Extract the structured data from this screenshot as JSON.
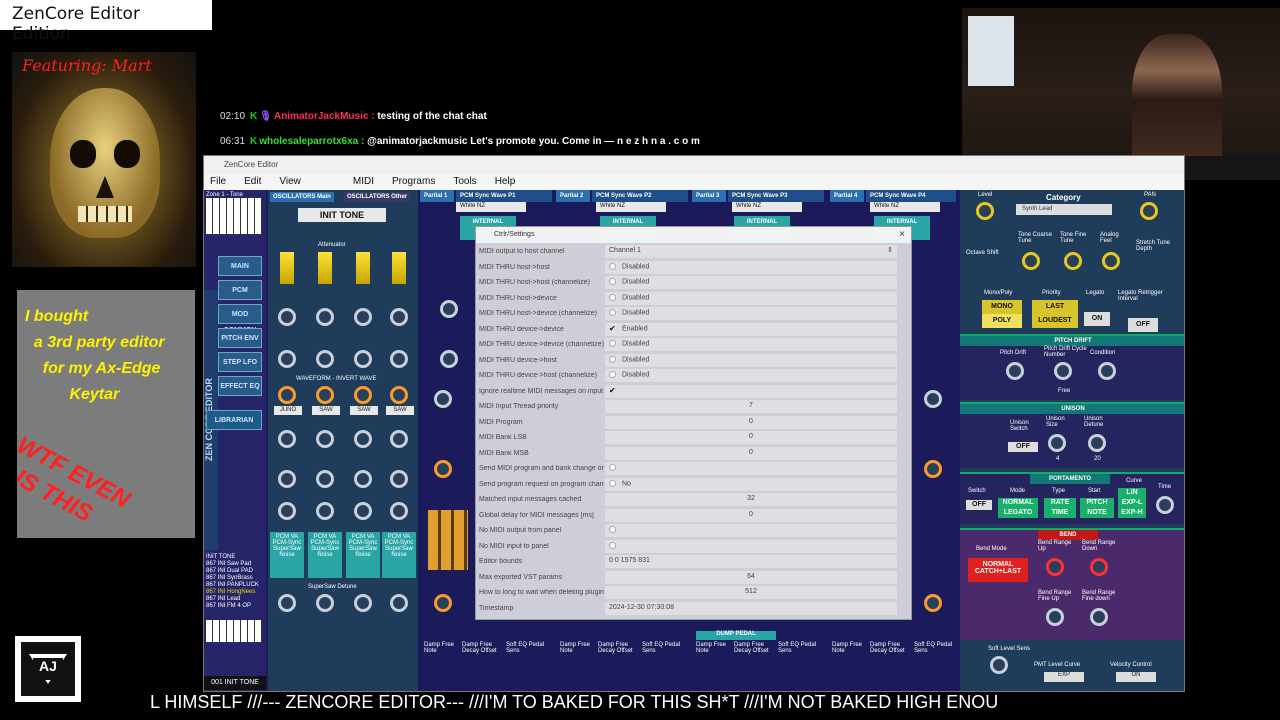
{
  "overlay": {
    "title": "ZenCore Editor Edition",
    "featuring": "Featuring: Mart",
    "bought_note": "I bought\n  a 3rd party editor\n    for my Ax-Edge\n          Keytar",
    "wtf_note": "WTF EVEN\n  IS THIS",
    "logo_text": "AJ",
    "ticker": "L HIMSELF   ///--- ZENCORE EDITOR---   ///I'M TO BAKED FOR THIS SH*T    ///I'M NOT BAKED HIGH ENOU"
  },
  "chat": [
    {
      "time": "02:10",
      "badge": "K",
      "user": "AnimatorJackMusic",
      "message": "testing of the chat chat"
    },
    {
      "time": "06:31",
      "badge": "K",
      "user": "wholesaleparrotx6xa",
      "message": "@animatorjackmusic Let's promote you. Come in — n e z h n a . c o m"
    }
  ],
  "editor": {
    "window_title": "ZenCore Editor",
    "menu": [
      "File",
      "Edit",
      "View",
      "MIDI",
      "Programs",
      "Tools",
      "Help"
    ],
    "zone_label": "Zone 1 - Tone",
    "osc_tabs": [
      "OSCILLATORS Main",
      "OSCILLATORS Other"
    ],
    "init_tone": "INIT TONE",
    "nav_buttons": [
      "MAIN",
      "PCM RANGE COMMON",
      "MOD MATRIX",
      "PITCH ENV",
      "STEP LFO",
      "EFFECT EQ",
      "LIBRARIAN"
    ],
    "vertical_brand": "ZEN CORE EDITOR",
    "patch_list": [
      "INIT TONE",
      "867 INI Saw Pad",
      "867 INI Dual PAD",
      "867 INI SynBrass",
      "867 INI PANPLUCK",
      "867 INI HongNees",
      "867 INI Lead",
      "867 INI FM 4 OP"
    ],
    "tone_footer": "001 INIT TONE",
    "attenuator": "Attenuator",
    "waveform_label": "WAVEFORM - INVERT WAVE",
    "wave_buttons": [
      "JUNO",
      "SAW",
      "SAW",
      "SAW"
    ],
    "pcm_cols": [
      "PCM VA PCM-Sync SuperSaw Noise",
      "PCM VA PCM-Sync SuperSaw Noise",
      "PCM VA PCM-Sync SuperSaw Noise",
      "PCM VA PCM-Sync SuperSaw Noise"
    ],
    "supersaw_label": "SuperSaw Detune",
    "partials": [
      {
        "head": "Partial 1",
        "wave": "PCM Sync Wave P1",
        "sel": "White NZ"
      },
      {
        "head": "Partial 2",
        "wave": "PCM Sync Wave P2",
        "sel": "White NZ"
      },
      {
        "head": "Partial 3",
        "wave": "PCM Sync Wave P3",
        "sel": "White NZ"
      },
      {
        "head": "Partial 4",
        "wave": "PCM Sync Wave P4",
        "sel": "White NZ"
      }
    ],
    "internal_label": "INTERNAL",
    "bottom_labels": [
      "Damp Free Note",
      "Damp Free Decay Offset",
      "Soft EQ Pedal Sens",
      "Damp Free Note",
      "Damp Free Decay Offset",
      "Soft EQ Pedal Sens",
      "Damp Free Note",
      "Damp Free Decay Offset",
      "Soft EQ Pedal Sens",
      "Damp Free Note",
      "Damp Free Decay Offset",
      "Soft EQ Pedal Sens"
    ],
    "dump_pedal": "DUMP PEDAL",
    "right": {
      "level": "Level",
      "category": "Category",
      "category_value": "Synth Lead",
      "pan": "PAN",
      "octave_shift": "Octave Shift",
      "tone_coarse": "Tone Coarse Tune",
      "tone_fine": "Tone Fine Tune",
      "analog_feel": "Analog Feel",
      "stretch": "Stretch Tune Depth",
      "mono_poly": "Mono/Poly",
      "mono": "MONO",
      "poly": "POLY",
      "priority": "Priority",
      "last": "LAST",
      "loudest": "LOUDEST",
      "legato": "Legato",
      "on": "ON",
      "retrigger": "Legato Retrigger Interval",
      "off": "OFF",
      "pitch_drift_head": "PITCH DRIFT",
      "pitch_drift": "Pitch Drift",
      "cycle_number": "Pitch Drift Cycle Number",
      "condition": "Condition",
      "free": "Free",
      "unison_head": "UNISON",
      "unison_switch": "Unison Switch",
      "unison_size": "Unison Size",
      "unison_detune": "Unison Detune",
      "unison_size_val": "4",
      "unison_detune_val": "20",
      "portamento_head": "PORTAMENTO",
      "switch": "Switch",
      "mode": "Mode",
      "type": "Type",
      "start": "Start",
      "curve": "Curve",
      "time": "Time",
      "normal_legato": "NORMAL LEGATO",
      "rate_time": "RATE TIME",
      "pitch_note": "PITCH NOTE",
      "lin": "LIN EXP-L EXP-H",
      "bend_head": "BEND",
      "bend_mode": "Bend Mode",
      "normal_catch": "NORMAL CATCH+LAST",
      "bend_up": "Bend Range Up",
      "bend_down": "Bend Range Down",
      "fine_up": "Bend Range Fine Up",
      "fine_down": "Bend Range Fine down",
      "soft_level": "Soft Level Sens",
      "pmt_curve": "PMT Level Curve",
      "vel_control": "Velocity Control",
      "exp": "EXP",
      "on2": "ON"
    }
  },
  "dialog": {
    "title": "Ctrlr/Settings",
    "close": "×",
    "rows": [
      {
        "label": "MIDI output to host channel",
        "value": "Channel 1",
        "kind": "select"
      },
      {
        "label": "MIDI THRU host->host",
        "value": "Disabled",
        "kind": "check",
        "on": false
      },
      {
        "label": "MIDI THRU host->host (channelize)",
        "value": "Disabled",
        "kind": "check",
        "on": false
      },
      {
        "label": "MIDI THRU host->device",
        "value": "Disabled",
        "kind": "check",
        "on": false
      },
      {
        "label": "MIDI THRU host->device (channelize)",
        "value": "Disabled",
        "kind": "check",
        "on": false
      },
      {
        "label": "MIDI THRU device->device",
        "value": "Enabled",
        "kind": "check",
        "on": true
      },
      {
        "label": "MIDI THRU device->device (channelize)",
        "value": "Disabled",
        "kind": "check",
        "on": false
      },
      {
        "label": "MIDI THRU device->host",
        "value": "Disabled",
        "kind": "check",
        "on": false
      },
      {
        "label": "MIDI THRU device->host (channelize)",
        "value": "Disabled",
        "kind": "check",
        "on": false
      },
      {
        "label": "Ignore realtime MIDI messages on input",
        "value": "",
        "kind": "check",
        "on": true
      },
      {
        "label": "MIDI Input Thread priority",
        "value": "7",
        "kind": "num"
      },
      {
        "label": "MIDI Program",
        "value": "0",
        "kind": "num"
      },
      {
        "label": "MIDI Bank LSB",
        "value": "0",
        "kind": "num"
      },
      {
        "label": "MIDI Bank MSB",
        "value": "0",
        "kind": "num"
      },
      {
        "label": "Send MIDI program and bank change on panel load",
        "value": "",
        "kind": "check",
        "on": false
      },
      {
        "label": "Send program request on program change",
        "value": "No",
        "kind": "check",
        "on": false
      },
      {
        "label": "Matched input messages cached",
        "value": "32",
        "kind": "num"
      },
      {
        "label": "Global delay for MIDI messages [ms]",
        "value": "0",
        "kind": "num"
      },
      {
        "label": "No MIDI output from panel",
        "value": "",
        "kind": "check",
        "on": false
      },
      {
        "label": "No MIDI input to panel",
        "value": "",
        "kind": "check",
        "on": false
      },
      {
        "label": "Editor bounds",
        "value": "0 0 1575 831",
        "kind": "text"
      },
      {
        "label": "Max exported VST params",
        "value": "64",
        "kind": "num"
      },
      {
        "label": "How to long to wait when deleting plugin",
        "value": "512",
        "kind": "num"
      },
      {
        "label": "Timestamp",
        "value": "2024-12-30 07:30:08",
        "kind": "text"
      }
    ]
  }
}
